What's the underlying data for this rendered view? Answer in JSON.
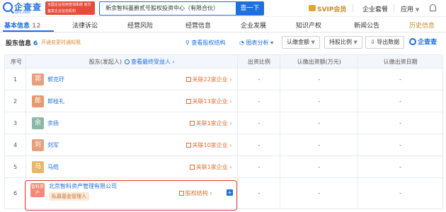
{
  "header": {
    "logo_name": "企查查",
    "logo_domain": "Qcc.com",
    "badge": "全国企业信用查询系统 官方备案企业征信机构",
    "search_value": "新余智科墨爵贰号股权投资中心（有限合伙）",
    "search_button": "查一下",
    "svip": "SVIP会员",
    "enterprise_suite": "企业套餐",
    "apps": "应用"
  },
  "tabs": [
    {
      "label": "基本信息",
      "count": "12"
    },
    {
      "label": "法律诉讼"
    },
    {
      "label": "经营风险"
    },
    {
      "label": "经营信息"
    },
    {
      "label": "企业发展"
    },
    {
      "label": "知识产权"
    },
    {
      "label": "新闻公告"
    },
    {
      "label": "历史信息"
    }
  ],
  "section": {
    "title": "股东信息",
    "count": "6",
    "notice_link": "开通变更时通知我",
    "equity_structure": "查看股权结构",
    "chart_analysis": "图表分析",
    "subscribed_amount": "认缴金额",
    "share_ratio": "持股比例",
    "export": "导出数据",
    "brand": "企查查"
  },
  "table": {
    "headers": {
      "index": "序号",
      "shareholder": "股东(发起人)",
      "beneficiary_link": "查看最终受益人",
      "ratio": "出资比例",
      "amount": "认缴出资额(万元)",
      "date": "认缴出资日期"
    },
    "rows": [
      {
        "index": "1",
        "avatar": "郭",
        "name": "郭克玗",
        "related": "关联22家企业",
        "ratio": "-",
        "amount": "-",
        "date": "-"
      },
      {
        "index": "2",
        "avatar": "郎",
        "name": "郎桂礼",
        "related": "关联13家企业",
        "ratio": "-",
        "amount": "-",
        "date": "-"
      },
      {
        "index": "3",
        "avatar": "余",
        "name": "余扬",
        "related": "关联1家企业",
        "ratio": "-",
        "amount": "-",
        "date": "-"
      },
      {
        "index": "4",
        "avatar": "刘",
        "name": "刘军",
        "related": "关联10家企业",
        "ratio": "-",
        "amount": "-",
        "date": "-"
      },
      {
        "index": "5",
        "avatar": "马",
        "name": "马皓",
        "related": "关联1家企业",
        "ratio": "-",
        "amount": "-",
        "date": "-"
      },
      {
        "index": "6",
        "avatar": "智科资产",
        "name": "北京智科资产管理有限公司",
        "tag": "私募基金管理人",
        "related": "股权结构",
        "ratio": "-",
        "amount": "-",
        "date": "-"
      }
    ]
  },
  "colors": {
    "accent": "#1e6fe0",
    "highlight_border": "#e53935",
    "avatar_1": "#e5a07e",
    "avatar_2": "#e59a6e",
    "avatar_3": "#8bb8a6",
    "avatar_4": "#e5a07e",
    "avatar_5": "#e8b86a"
  }
}
